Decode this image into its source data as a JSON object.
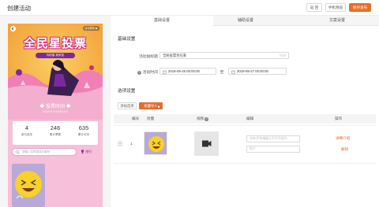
{
  "header": {
    "title": "创建活动",
    "buttons": {
      "back": "返 回",
      "preview": "手机预览",
      "save": "保存发布"
    }
  },
  "preview": {
    "corner_badge": "活动规则 ▶",
    "headline": "全民星投票",
    "subhead": "你的星 我来投",
    "time_title": "◆ 投票时间 ◆",
    "time_value": "2019.9.3~2019.9.5",
    "stats": [
      {
        "value": "4",
        "label": "参与选手"
      },
      {
        "value": "246",
        "label": "累计票数"
      },
      {
        "value": "635",
        "label": "累计访问"
      }
    ],
    "search_placeholder": "请输入名称或选手编号",
    "rank_label": "排行"
  },
  "tabs": [
    "基础设置",
    "辅助设置",
    "文案设置"
  ],
  "basic": {
    "section_title": "基础设置",
    "name_label": "活动副标题",
    "name_value": "全民投票亲在来",
    "name_counter": "7/20",
    "time_label": "活动时间",
    "start_time": "2019-09-26 00:00:00",
    "separator": "至",
    "end_time": "2019-09-27 00:00:00"
  },
  "options": {
    "section_title": "选项设置",
    "add_button": "添加选项",
    "import_button": "批量导入",
    "columns": [
      "编号",
      "封面",
      "视频",
      "编辑",
      "操作"
    ],
    "rows": [
      {
        "number": "1",
        "name_placeholder": "名称(手机端展示不可不填写)",
        "desc_placeholder": "简介",
        "actions": [
          "详细介绍",
          "删除"
        ]
      }
    ]
  },
  "colors": {
    "accent": "#e86d2c",
    "preview_bg": "#f7bfd9",
    "banner": "#f4a13b",
    "magenta": "#d5287d",
    "purple": "#7a2a9f"
  }
}
